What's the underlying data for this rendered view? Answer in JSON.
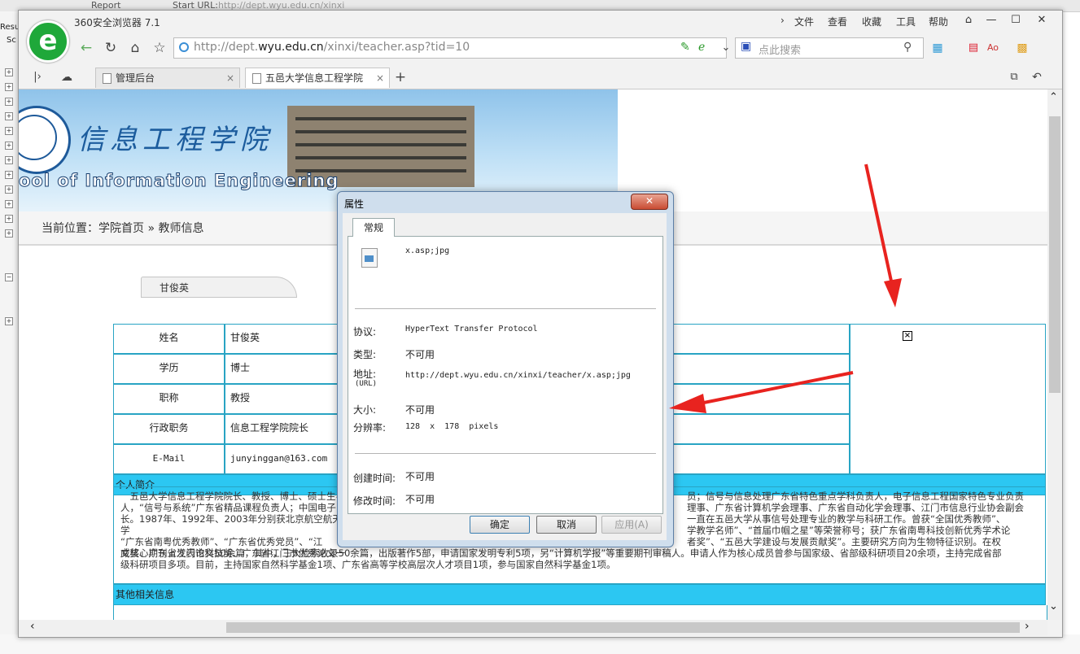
{
  "background": {
    "start_url_label": "Start URL:",
    "start_url_value": "http://dept.wyu.edu.cn/xinxi",
    "report_label": "Report",
    "left_items": [
      "Resu",
      "Sc"
    ]
  },
  "browser": {
    "title": "360安全浏览器 7.1",
    "menu": [
      "文件",
      "查看",
      "收藏",
      "工具",
      "帮助"
    ],
    "address": {
      "prefix": "http://dept.",
      "domain": "wyu.edu.cn",
      "path": "/xinxi/teacher.asp?tid=10"
    },
    "search_placeholder": "点此搜索",
    "tabs": [
      {
        "label": "管理后台"
      },
      {
        "label": "五邑大学信息工程学院"
      }
    ]
  },
  "page": {
    "banner_title_cn": "信息工程学院",
    "banner_title_en": "ool of Information Engineering",
    "breadcrumb": "当前位置：学院首页 » 教师信息",
    "teacher_name_tab": "甘俊英",
    "profile_rows": [
      {
        "label": "姓名",
        "value": "甘俊英"
      },
      {
        "label": "学历",
        "value": "博士"
      },
      {
        "label": "职称",
        "value": "教授"
      },
      {
        "label": "行政职务",
        "value": "信息工程学院院长"
      },
      {
        "label": "E-Mail",
        "value": "junyinggan@163.com"
      }
    ],
    "section_intro": "个人简介",
    "intro_lines": [
      "五邑大学信息工程学院院长、教授、博士、硕士生导师",
      "人，“信号与系统”广东省精品课程负责人；中国电子",
      "长。1987年、1992年、2003年分别获北京航空航天大学",
      "“广东省南粤优秀教师”、“广东省优秀党员”、“江",
      "文奖、广东省江门市科技奖、广东省江门市优秀论文一",
      "威核心期刊上发表论文50余篇，其中，三大检索收录50余篇，出版著作5部，申请国家发明专利5项，另“计算机学报”等重要期刊审稿人。申请人作为核心成员曾参与国家级、省部级科研项目20余项，主持完成省部",
      "级科研项目多项。目前，主持国家自然科学基金1项、广东省高等学校高层次人才项目1项，参与国家自然科学基金1项。"
    ],
    "intro_right_lines": [
      "员；信号与信息处理广东省特色重点学科负责人，电子信息工程国家特色专业负责",
      "理事、广东省计算机学会理事、广东省自动化学会理事、江门市信息行业协会副会",
      "一直在五邑大学从事信号处理专业的教学与科研工作。曾获“全国优秀教师”、",
      "学教学名师”、“首届巾帼之星”等荣誉称号；获广东省南粤科技创新优秀学术论",
      "者奖”、“五邑大学建设与发展贡献奖”。主要研究方向为生物特征识别。在权"
    ],
    "section_other": "其他相关信息"
  },
  "dialog": {
    "title": "属性",
    "tab": "常规",
    "filename": "x.asp;jpg",
    "props": [
      {
        "label": "协议:",
        "value": "HyperText Transfer Protocol"
      },
      {
        "label": "类型:",
        "value": "不可用"
      },
      {
        "label": "地址:",
        "sub": "(URL)",
        "value": "http://dept.wyu.edu.cn/xinxi/teacher/x.asp;jpg"
      },
      {
        "label": "大小:",
        "value": "不可用"
      },
      {
        "label": "分辨率:",
        "value": "128  x  178  pixels"
      }
    ],
    "dates": [
      {
        "label": "创建时间:",
        "value": "不可用"
      },
      {
        "label": "修改时间:",
        "value": "不可用"
      }
    ],
    "buttons": {
      "ok": "确定",
      "cancel": "取消",
      "apply": "应用(A)"
    }
  },
  "colors": {
    "table_border": "#29a4c4",
    "section_bar": "#2cc7f2",
    "annotation_arrow": "#e8231f"
  }
}
